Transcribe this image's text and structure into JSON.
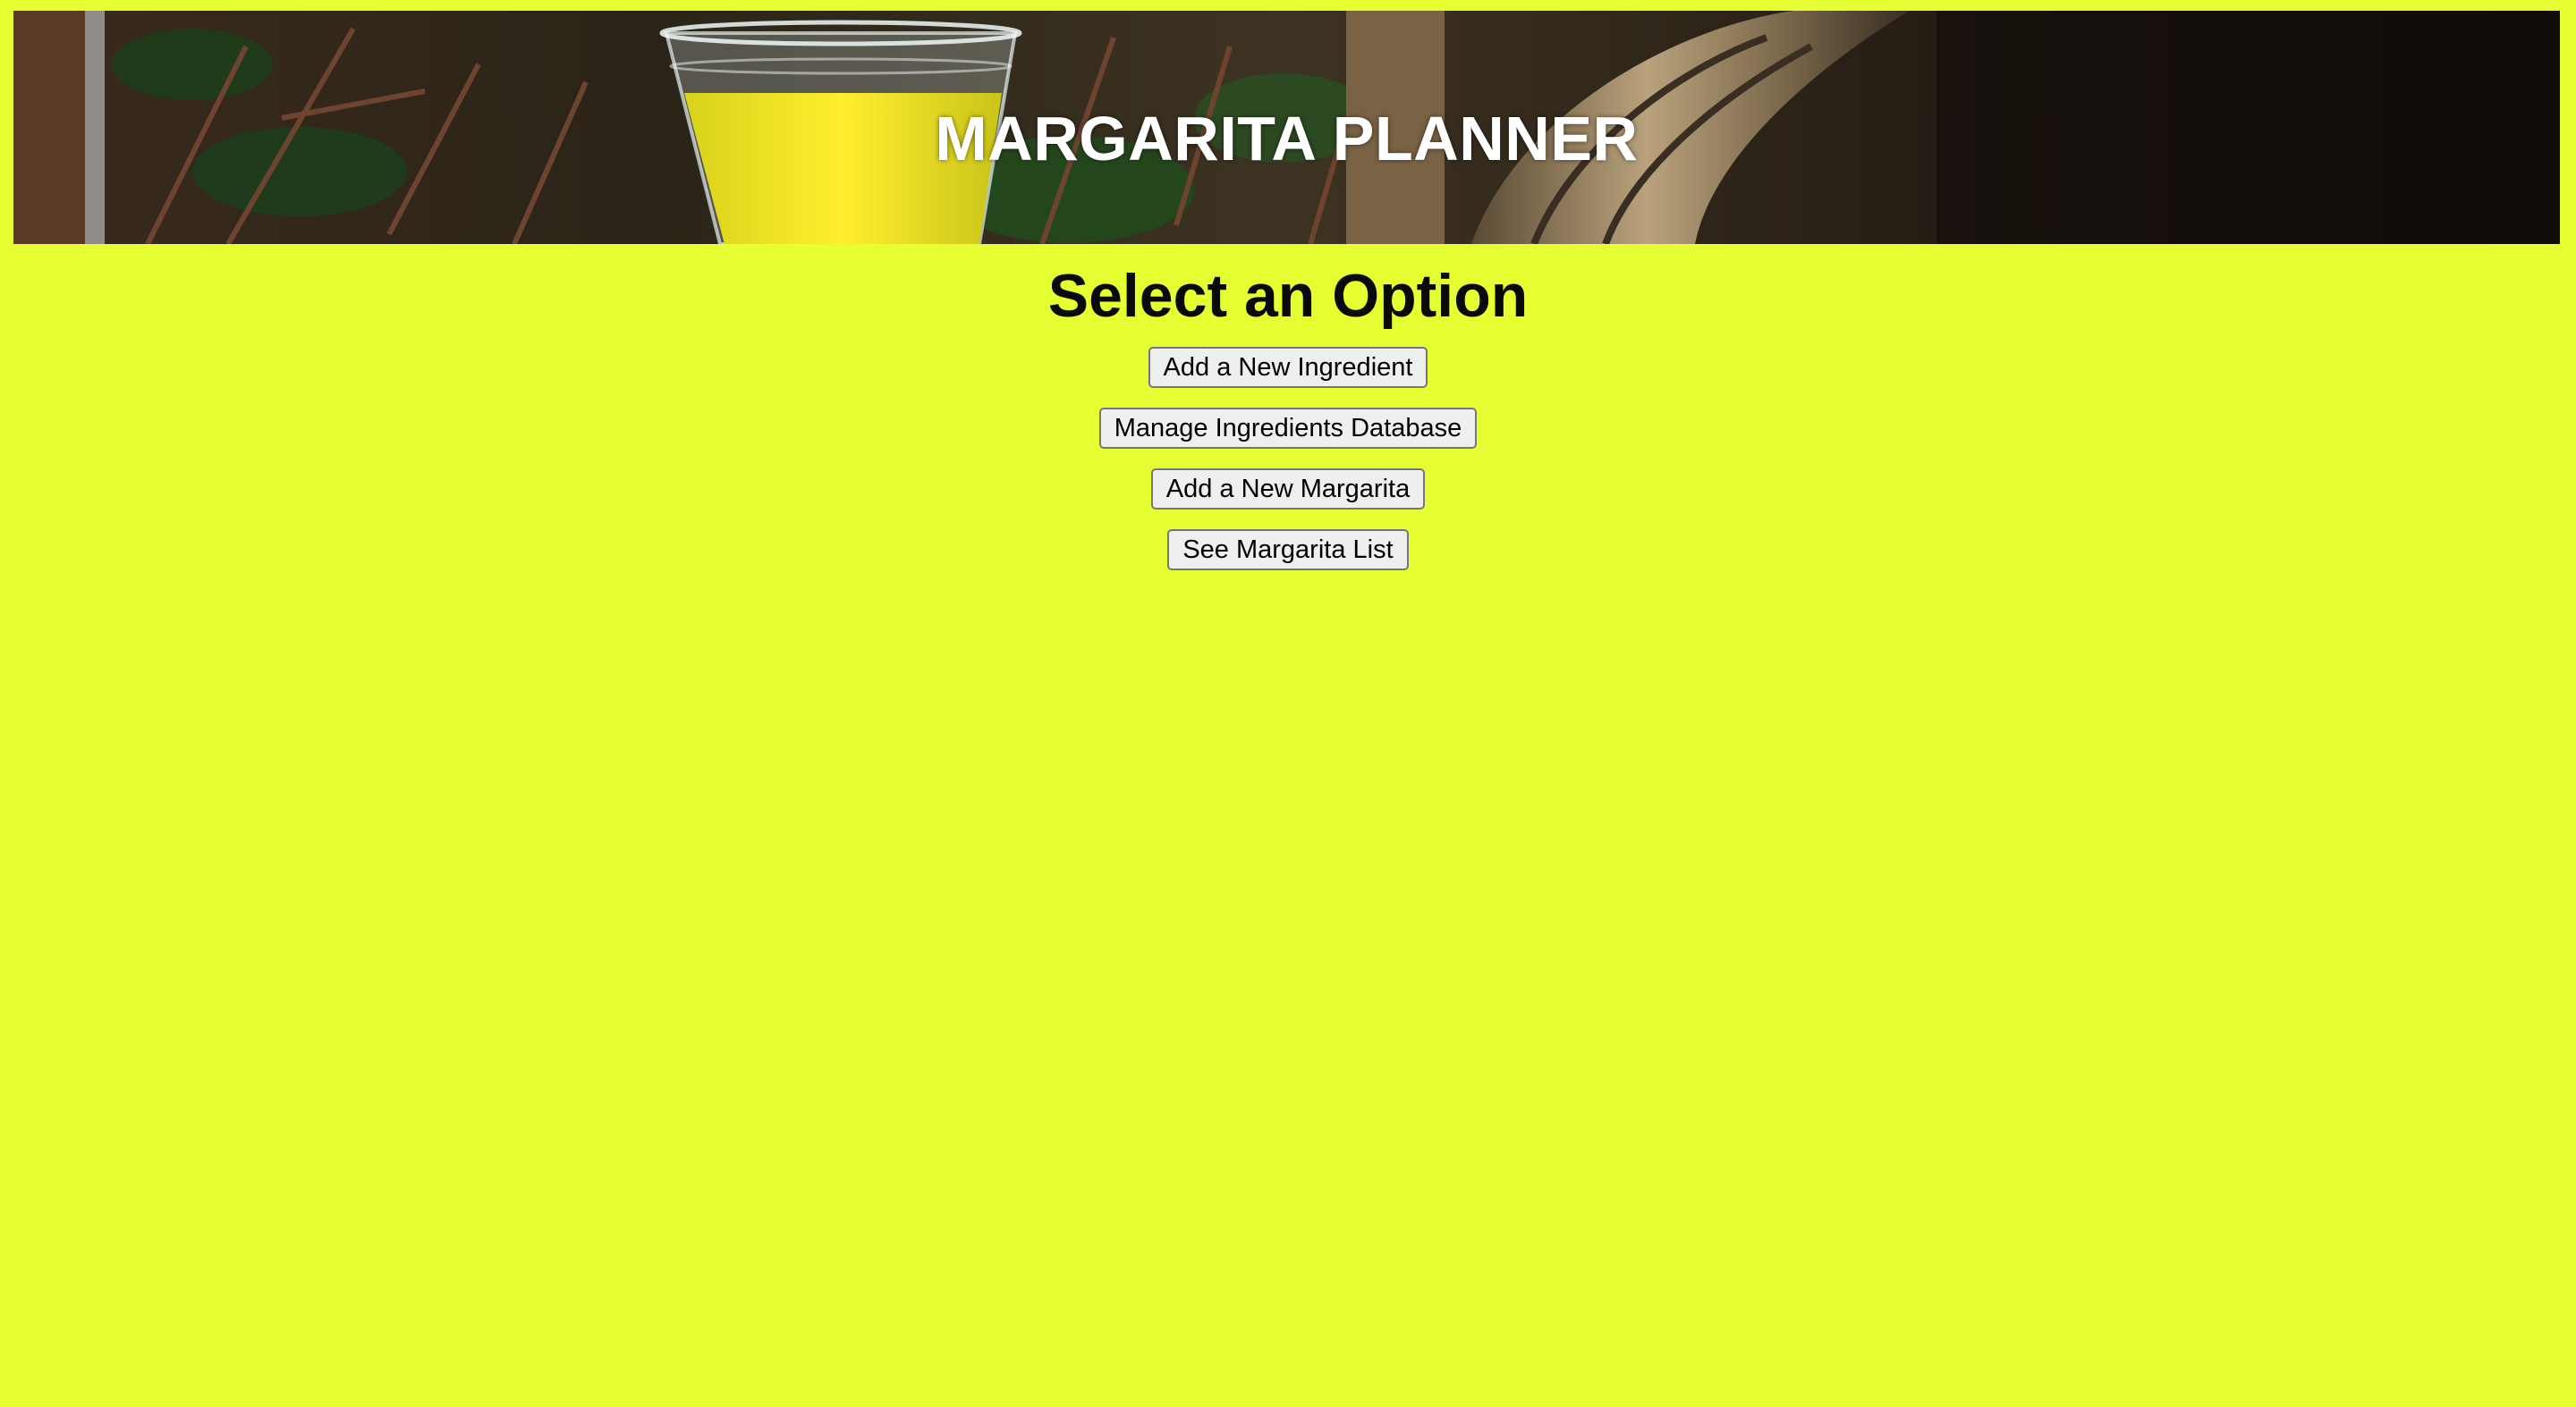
{
  "banner": {
    "title": "MARGARITA PLANNER"
  },
  "main": {
    "heading": "Select an Option",
    "buttons": [
      {
        "label": "Add a New Ingredient"
      },
      {
        "label": "Manage Ingredients Database"
      },
      {
        "label": "Add a New Margarita"
      },
      {
        "label": "See Margarita List"
      }
    ]
  },
  "colors": {
    "page_background": "#e5ff33",
    "banner_title": "#ffffff",
    "drink": "#f2e625"
  }
}
